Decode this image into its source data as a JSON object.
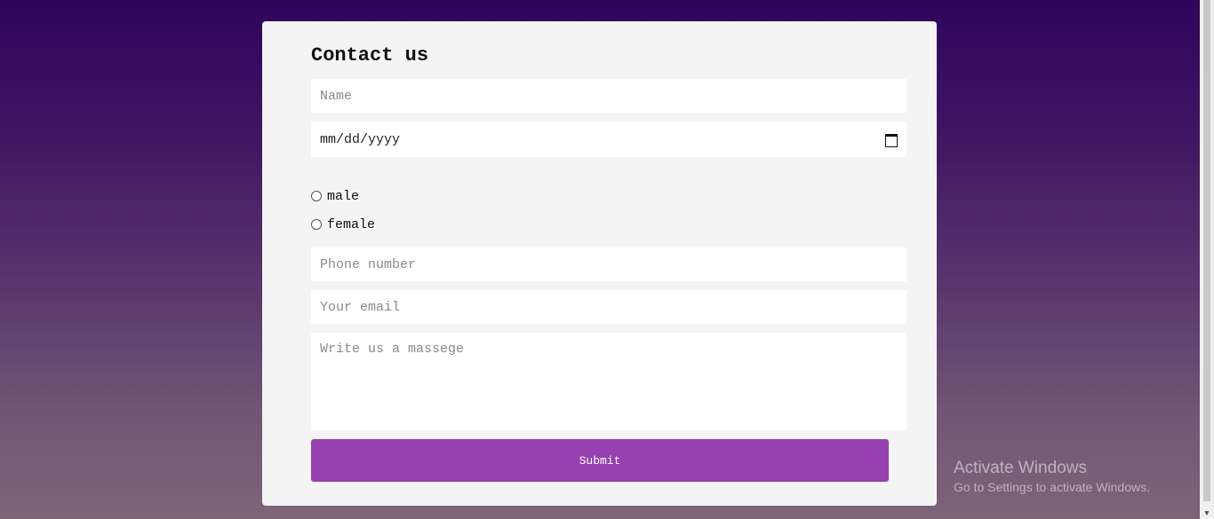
{
  "form": {
    "title": "Contact us",
    "name_placeholder": "Name",
    "date_placeholder": "mm/dd/yyyy",
    "gender_options": [
      "male",
      "female"
    ],
    "phone_placeholder": "Phone number",
    "email_placeholder": "Your email",
    "message_placeholder": "Write us a massege",
    "submit_label": "Submit"
  },
  "watermark": {
    "title": "Activate Windows",
    "subtitle": "Go to Settings to activate Windows."
  },
  "colors": {
    "accent": "#9640af",
    "card": "#f4f4f4",
    "background_top": "#2f055c",
    "background_bottom": "#7e6478"
  },
  "icons": {
    "date": "calendar-icon",
    "scroll_down": "chevron-down-icon"
  }
}
